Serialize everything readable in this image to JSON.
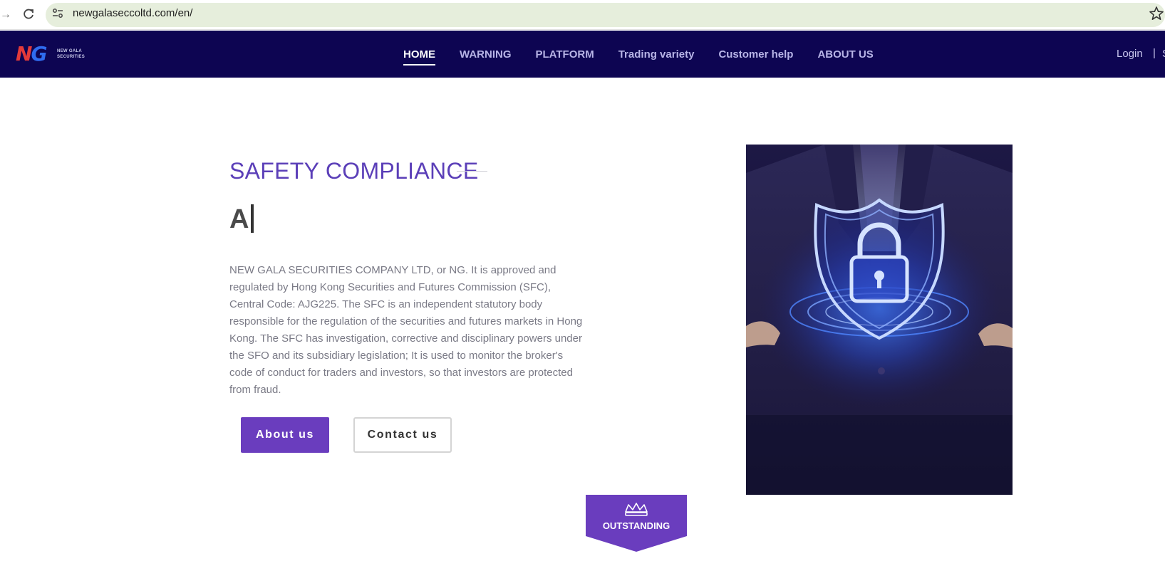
{
  "browser": {
    "url": "newgalaseccoltd.com/en/"
  },
  "header": {
    "logo_mark_n": "N",
    "logo_mark_g": "G",
    "logo_text": "NEW GALA SECURITIES",
    "nav": [
      {
        "label": "HOME",
        "active": true
      },
      {
        "label": "WARNING",
        "active": false
      },
      {
        "label": "PLATFORM",
        "active": false
      },
      {
        "label": "Trading variety",
        "active": false
      },
      {
        "label": "Customer help",
        "active": false
      },
      {
        "label": "ABOUT US",
        "active": false
      }
    ],
    "login_label": "Login",
    "separator": "|",
    "signup_partial": "S"
  },
  "main": {
    "section_title": "SAFETY COMPLIANCE",
    "typed_text": "A",
    "intro": "NEW GALA SECURITIES COMPANY LTD, or NG. It is approved and regulated by Hong Kong Securities and Futures Commission (SFC), Central Code: AJG225. The SFC is an independent statutory body responsible for the regulation of the securities and futures markets in Hong Kong. The SFC has investigation, corrective and disciplinary powers under the SFO and its subsidiary legislation; It is used to monitor the broker's code of conduct for traders and investors, so that investors are protected from fraud.",
    "about_button": "About us",
    "contact_button": "Contact us",
    "badge_label": "OUTSTANDING"
  },
  "colors": {
    "header_bg": "#0d0552",
    "accent_purple": "#6a3dbe",
    "title_purple": "#5b3fb8"
  }
}
